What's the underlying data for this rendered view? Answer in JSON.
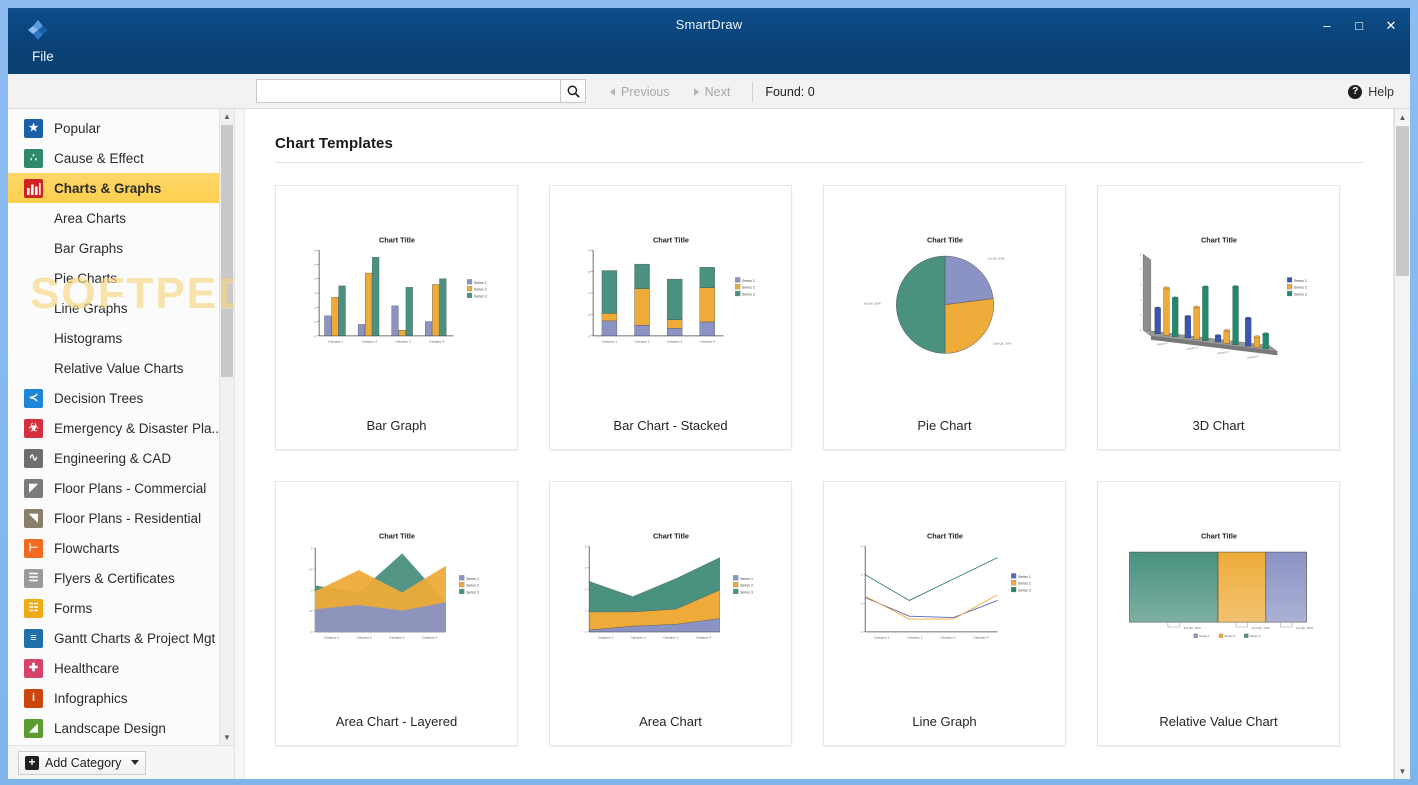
{
  "window": {
    "title": "SmartDraw",
    "logo_icon": "smartdraw-diamond-logo",
    "minimize_label": "–",
    "maximize_label": "□",
    "close_label": "✕",
    "menu": {
      "file_label": "File"
    }
  },
  "toolbar": {
    "search_value": "",
    "search_placeholder": "",
    "search_icon": "search-icon",
    "previous_label": "Previous",
    "next_label": "Next",
    "found_label": "Found: 0",
    "help_label": "Help",
    "help_icon": "help-question-icon"
  },
  "sidebar": {
    "items": [
      {
        "label": "Popular",
        "icon": "star-icon",
        "color": "#1a5fa8",
        "glyph": "★",
        "selected": false,
        "sub": false
      },
      {
        "label": "Cause & Effect",
        "icon": "fishbone-icon",
        "color": "#2f8a6a",
        "glyph": "∴",
        "selected": false,
        "sub": false
      },
      {
        "label": "Charts & Graphs",
        "icon": "bar-chart-icon",
        "color": "#cf2222",
        "glyph": "",
        "selected": true,
        "sub": false
      },
      {
        "label": "Area Charts",
        "icon": "",
        "color": "",
        "glyph": "",
        "selected": false,
        "sub": true
      },
      {
        "label": "Bar Graphs",
        "icon": "",
        "color": "",
        "glyph": "",
        "selected": false,
        "sub": true
      },
      {
        "label": "Pie Charts",
        "icon": "",
        "color": "",
        "glyph": "",
        "selected": false,
        "sub": true
      },
      {
        "label": "Line Graphs",
        "icon": "",
        "color": "",
        "glyph": "",
        "selected": false,
        "sub": true
      },
      {
        "label": "Histograms",
        "icon": "",
        "color": "",
        "glyph": "",
        "selected": false,
        "sub": true
      },
      {
        "label": "Relative Value Charts",
        "icon": "",
        "color": "",
        "glyph": "",
        "selected": false,
        "sub": true
      },
      {
        "label": "Decision Trees",
        "icon": "decision-tree-icon",
        "color": "#1e86d6",
        "glyph": "≺",
        "selected": false,
        "sub": false
      },
      {
        "label": "Emergency & Disaster Pla...",
        "icon": "emergency-icon",
        "color": "#d32f3f",
        "glyph": "☣",
        "selected": false,
        "sub": false
      },
      {
        "label": "Engineering & CAD",
        "icon": "engineering-icon",
        "color": "#6e6e6e",
        "glyph": "∿",
        "selected": false,
        "sub": false
      },
      {
        "label": "Floor Plans - Commercial",
        "icon": "floorplan-commercial-icon",
        "color": "#7b7b7b",
        "glyph": "◤",
        "selected": false,
        "sub": false
      },
      {
        "label": "Floor Plans - Residential",
        "icon": "floorplan-residential-icon",
        "color": "#8a7f6a",
        "glyph": "◥",
        "selected": false,
        "sub": false
      },
      {
        "label": "Flowcharts",
        "icon": "flowchart-icon",
        "color": "#f06a22",
        "glyph": "⊢",
        "selected": false,
        "sub": false
      },
      {
        "label": "Flyers & Certificates",
        "icon": "document-icon",
        "color": "#9a9a9a",
        "glyph": "☰",
        "selected": false,
        "sub": false
      },
      {
        "label": "Forms",
        "icon": "form-icon",
        "color": "#edab16",
        "glyph": "☷",
        "selected": false,
        "sub": false
      },
      {
        "label": "Gantt Charts & Project Mgt",
        "icon": "gantt-icon",
        "color": "#1f6fa8",
        "glyph": "≡",
        "selected": false,
        "sub": false
      },
      {
        "label": "Healthcare",
        "icon": "healthcare-cross-icon",
        "color": "#d6426a",
        "glyph": "✚",
        "selected": false,
        "sub": false
      },
      {
        "label": "Infographics",
        "icon": "info-icon",
        "color": "#c9470f",
        "glyph": "i",
        "selected": false,
        "sub": false
      },
      {
        "label": "Landscape Design",
        "icon": "landscape-icon",
        "color": "#5a9c2f",
        "glyph": "◢",
        "selected": false,
        "sub": false
      }
    ],
    "add_category_label": "Add Category",
    "add_category_icon": "plus-icon",
    "add_category_caret_icon": "chevron-down-icon",
    "scroll_up_icon": "chevron-up-icon",
    "scroll_down_icon": "chevron-down-icon"
  },
  "main": {
    "section_title": "Chart Templates",
    "scroll_up_icon": "chevron-up-icon",
    "scroll_down_icon": "chevron-down-icon",
    "tiles": [
      {
        "label": "Bar Graph",
        "thumb": "bar-graph"
      },
      {
        "label": "Bar Chart - Stacked",
        "thumb": "bar-stacked"
      },
      {
        "label": "Pie Chart",
        "thumb": "pie"
      },
      {
        "label": "3D Chart",
        "thumb": "chart-3d"
      },
      {
        "label": "Area Chart - Layered",
        "thumb": "area-layered"
      },
      {
        "label": "Area Chart",
        "thumb": "area-stacked"
      },
      {
        "label": "Line Graph",
        "thumb": "line"
      },
      {
        "label": "Relative Value Chart",
        "thumb": "relative-value"
      }
    ]
  },
  "watermark": {
    "text": "SOFTPEDIA",
    "mark": "®"
  },
  "colors": {
    "titlebar": "#0a4176",
    "accent_selected": "#fccf4e",
    "series1": "#8b93c4",
    "series2": "#eeab3a",
    "series3": "#4a9180"
  },
  "chart_data": [
    {
      "id": "bar-graph",
      "type": "bar",
      "title": "Chart Title",
      "categories": [
        "Category 1",
        "Category 2",
        "Category 3",
        "Category 4"
      ],
      "series": [
        {
          "name": "Series 1",
          "values": [
            1.4,
            0.8,
            2.1,
            1.0
          ],
          "color": "#8b93c4"
        },
        {
          "name": "Series 2",
          "values": [
            2.7,
            4.4,
            0.4,
            3.6
          ],
          "color": "#eeab3a"
        },
        {
          "name": "Series 3",
          "values": [
            3.5,
            5.5,
            3.4,
            4.0
          ],
          "color": "#4a9180"
        }
      ],
      "ylim": [
        0,
        6
      ],
      "yticks": [
        "0",
        "1",
        "2",
        "3",
        "4",
        "5",
        "6"
      ],
      "legend": "right",
      "grid": false
    },
    {
      "id": "bar-stacked",
      "type": "bar",
      "stacked": true,
      "title": "Chart Title",
      "categories": [
        "Category 1",
        "Category 2",
        "Category 3",
        "Category 4"
      ],
      "series": [
        {
          "name": "Series 1",
          "values": [
            1.4,
            1.0,
            0.7,
            1.3
          ],
          "color": "#8b93c4"
        },
        {
          "name": "Series 2",
          "values": [
            0.7,
            3.4,
            0.8,
            3.2
          ],
          "color": "#eeab3a"
        },
        {
          "name": "Series 3",
          "values": [
            4.0,
            2.3,
            3.8,
            1.9
          ],
          "color": "#4a9180"
        }
      ],
      "ylim": [
        0,
        8
      ],
      "yticks": [
        "0",
        "2",
        "4",
        "6",
        "8"
      ],
      "legend": "right",
      "grid": false
    },
    {
      "id": "pie",
      "type": "pie",
      "title": "Chart Title",
      "labels": [
        "1st Qtr, 23%",
        "2nd Qtr, 27%",
        "3rd Qtr, 50%"
      ],
      "values": [
        23,
        27,
        50
      ],
      "colors": [
        "#8b93c4",
        "#eeab3a",
        "#4a9180"
      ],
      "legend": "labels-outside"
    },
    {
      "id": "chart-3d",
      "type": "bar",
      "three_d": true,
      "title": "Chart Title",
      "categories": [
        "Category 1",
        "Category 2",
        "Category 3",
        "Category 4"
      ],
      "series": [
        {
          "name": "Series 1",
          "values": [
            2.4,
            2.0,
            0.6,
            2.6
          ],
          "color": "#3a56b0"
        },
        {
          "name": "Series 2",
          "values": [
            4.4,
            3.0,
            1.2,
            1.0
          ],
          "color": "#eeab3a"
        },
        {
          "name": "Series 3",
          "values": [
            3.6,
            5.0,
            5.4,
            1.4
          ],
          "color": "#1d8c6e"
        }
      ],
      "ylim": [
        0,
        6
      ],
      "legend": "right",
      "grid": false
    },
    {
      "id": "area-layered",
      "type": "area",
      "title": "Chart Title",
      "categories": [
        "Category 1",
        "Category 2",
        "Category 3",
        "Category 4"
      ],
      "series": [
        {
          "name": "Series 1",
          "values": [
            1.6,
            1.9,
            1.5,
            2.1
          ],
          "color": "#8b93c4"
        },
        {
          "name": "Series 2",
          "values": [
            2.9,
            4.4,
            2.8,
            4.7
          ],
          "color": "#eeab3a"
        },
        {
          "name": "Series 3",
          "values": [
            3.3,
            2.8,
            5.6,
            2.1
          ],
          "color": "#4a9180"
        }
      ],
      "ylim": [
        0,
        6
      ],
      "legend": "right",
      "grid": false
    },
    {
      "id": "area-stacked",
      "type": "area",
      "stacked": true,
      "title": "Chart Title",
      "categories": [
        "Category 1",
        "Category 2",
        "Category 3",
        "Category 4"
      ],
      "series": [
        {
          "name": "Series 1",
          "values": [
            0.2,
            0.6,
            0.8,
            1.4
          ],
          "color": "#8b93c4"
        },
        {
          "name": "Series 2",
          "values": [
            1.9,
            1.5,
            1.6,
            3.0
          ],
          "color": "#eeab3a"
        },
        {
          "name": "Series 3",
          "values": [
            3.2,
            1.6,
            3.2,
            3.4
          ],
          "color": "#4a9180"
        }
      ],
      "ylim": [
        0,
        9
      ],
      "legend": "right",
      "grid": false
    },
    {
      "id": "line",
      "type": "line",
      "title": "Chart Title",
      "categories": [
        "Category 1",
        "Category 2",
        "Category 3",
        "Category 4"
      ],
      "series": [
        {
          "name": "Series 1",
          "values": [
            2.4,
            1.1,
            1.0,
            2.2
          ],
          "color": "#5a68b8"
        },
        {
          "name": "Series 2",
          "values": [
            2.5,
            0.9,
            0.9,
            2.6
          ],
          "color": "#eeab3a"
        },
        {
          "name": "Series 3",
          "values": [
            4.0,
            2.2,
            3.7,
            5.2
          ],
          "color": "#2f7f60"
        }
      ],
      "ylim": [
        0,
        6
      ],
      "legend": "right",
      "grid": false
    },
    {
      "id": "relative-value",
      "type": "bar",
      "relative": true,
      "title": "Chart Title",
      "labels": [
        "3rd Qtr, 50%",
        "2nd Qtr, 27%",
        "1st Qtr, 23%"
      ],
      "values": [
        50,
        27,
        23
      ],
      "colors": [
        "#4a9180",
        "#eeab3a",
        "#8b93c4"
      ],
      "legend_entries": [
        "Series 1",
        "Series 2",
        "Series 3"
      ]
    }
  ]
}
